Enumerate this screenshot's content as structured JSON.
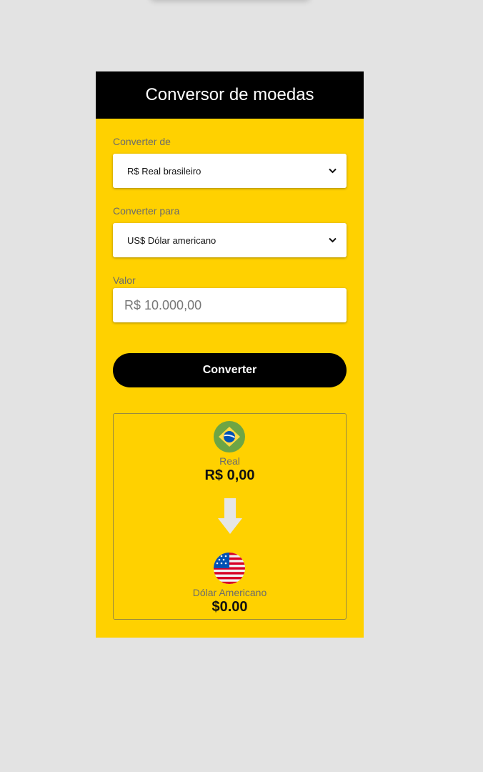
{
  "header": {
    "title": "Conversor de moedas"
  },
  "form": {
    "from": {
      "label": "Converter de",
      "selected": "R$ Real brasileiro"
    },
    "to": {
      "label": "Converter para",
      "selected": "US$ Dólar americano"
    },
    "amount": {
      "label": "Valor",
      "placeholder": "R$ 10.000,00"
    },
    "convert_button": "Converter"
  },
  "result": {
    "source": {
      "name": "Real",
      "value": "R$ 0,00",
      "flag": "brazil-flag-icon"
    },
    "target": {
      "name": "Dólar Americano",
      "value": "$0.00",
      "flag": "usa-flag-icon"
    },
    "arrow_icon": "arrow-down-icon"
  },
  "colors": {
    "background": "#e3e3e3",
    "card": "#ffd100",
    "header": "#000000",
    "button": "#000000"
  }
}
